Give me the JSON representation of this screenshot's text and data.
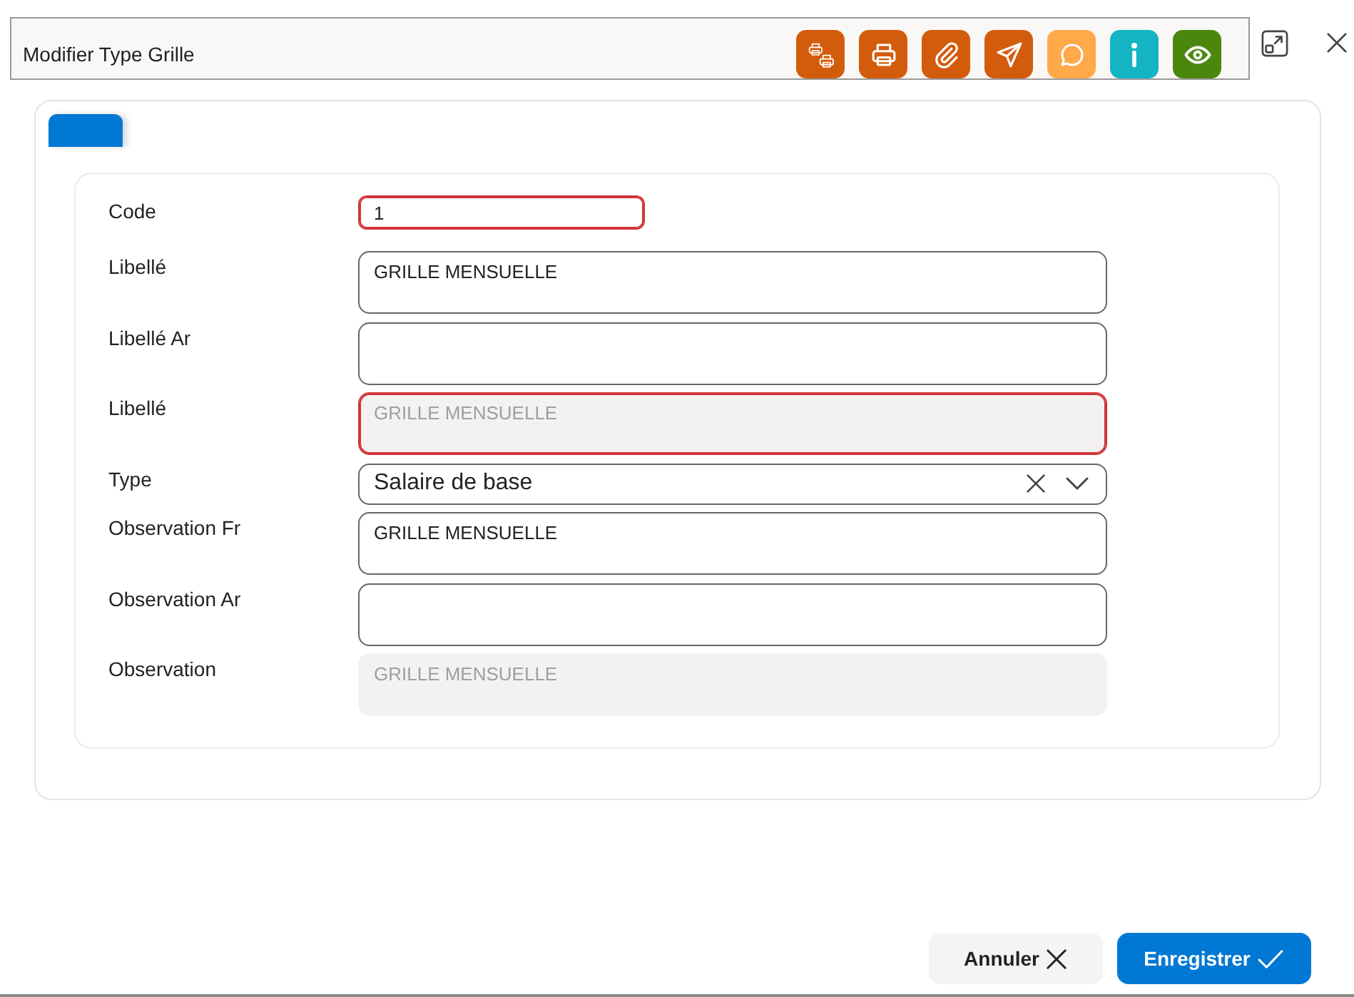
{
  "header": {
    "title": "Modifier Type Grille",
    "actions": [
      {
        "kind": "print-multiple",
        "color": "#d35c0c"
      },
      {
        "kind": "print",
        "color": "#d35c0c"
      },
      {
        "kind": "attach",
        "color": "#d35c0c"
      },
      {
        "kind": "send",
        "color": "#d35c0c"
      },
      {
        "kind": "comment",
        "color": "#ffa94a"
      },
      {
        "kind": "info",
        "color": "#14b4c4"
      },
      {
        "kind": "view",
        "color": "#4b870c"
      }
    ]
  },
  "tabs": [
    {
      "selected": true
    }
  ],
  "form": {
    "fields": [
      {
        "label": "Code",
        "kind": "input",
        "value": "1",
        "invalid": true,
        "disabled": false
      },
      {
        "label": "Libellé",
        "kind": "textarea",
        "value": "GRILLE MENSUELLE",
        "invalid": false,
        "disabled": false
      },
      {
        "label": "Libellé Ar",
        "kind": "textarea",
        "invalid": false,
        "disabled": false
      },
      {
        "label": "Libellé",
        "kind": "textarea",
        "value": "GRILLE MENSUELLE",
        "invalid": true,
        "disabled": true
      },
      {
        "label": "Type",
        "kind": "select",
        "value": "Salaire de base",
        "clearable": true,
        "invalid": false,
        "disabled": false
      },
      {
        "label": "Observation Fr",
        "kind": "textarea",
        "value": "GRILLE MENSUELLE",
        "invalid": false,
        "disabled": false
      },
      {
        "label": "Observation Ar",
        "kind": "textarea",
        "invalid": false,
        "disabled": false
      },
      {
        "label": "Observation",
        "kind": "textarea",
        "value": "GRILLE MENSUELLE",
        "invalid": false,
        "disabled": true
      }
    ]
  },
  "buttons": [
    {
      "label": "Annuler",
      "kind": "cancel"
    },
    {
      "label": "Enregistrer",
      "kind": "save"
    }
  ]
}
